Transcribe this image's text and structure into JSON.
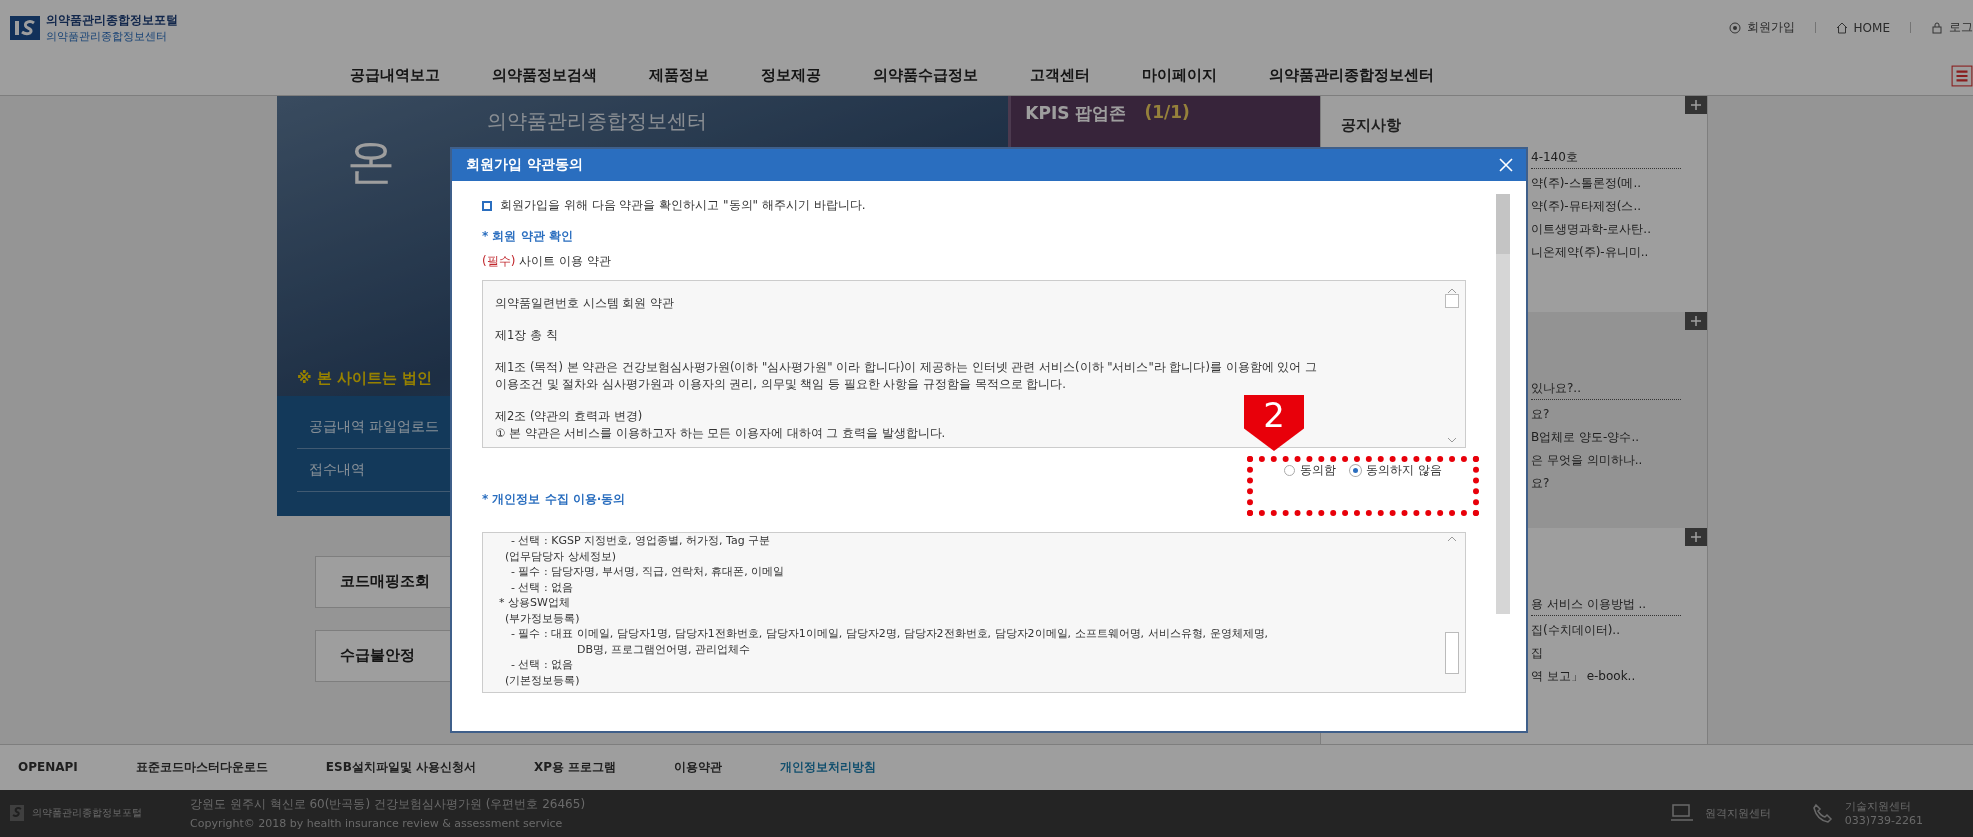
{
  "header": {
    "logo_title": "의약품관리종합정보포털",
    "logo_subtitle": "의약품관리종합정보센터",
    "links": [
      "회원가입",
      "HOME",
      "로그"
    ]
  },
  "nav": {
    "items": [
      "공급내역보고",
      "의약품정보검색",
      "제품정보",
      "정보제공",
      "의약품수급정보",
      "고객센터",
      "마이페이지",
      "의약품관리종합정보센터"
    ]
  },
  "banner": {
    "heading": "의약품관리종합정보센터",
    "big_text": "온",
    "notice": "※ 본 사이트는 법인",
    "menu": [
      "공급내역 파일업로드",
      "접수내역"
    ],
    "popup_title": "KPIS 팝업존",
    "popup_count": "(1/1)"
  },
  "quick_buttons": [
    "코드매핑조회",
    "수급불안정"
  ],
  "side_panels": [
    {
      "title": "공지사항",
      "items": [
        "4-140호",
        "약(주)-스톨론정(메..",
        "약(주)-뮤타제정(스..",
        "이트생명과학-로사탄..",
        "니온제약(주)-유니미.."
      ]
    },
    {
      "items": [
        "있나요?..",
        "요?",
        "B업체로 양도-양수..",
        "은 무엇을 의미하나..",
        "요?"
      ]
    },
    {
      "items": [
        "용 서비스 이용방법 ..",
        "집(수치데이터)..",
        "집",
        "역 보고」 e-book.."
      ]
    }
  ],
  "modal": {
    "title": "회원가입 약관동의",
    "intro": "회원가입을 위해 다음 약관을 확인하시고 \"동의\" 해주시기 바랍니다.",
    "section_1": {
      "title": "* 회원 약관 확인",
      "required_tag": "(필수)",
      "label": "사이트 이용 약관",
      "paragraphs": [
        [
          "의약품일련번호 시스템 회원 약관"
        ],
        [
          "제1장 총 칙"
        ],
        [
          "제1조 (목적) 본 약관은 건강보험심사평가원(이하 \"심사평가원\" 이라 합니다)이 제공하는 인터넷 관련 서비스(이하 \"서비스\"라 합니다)를 이용함에 있어 그",
          "이용조건 및 절차와 심사평가원과 이용자의 권리, 의무및 책임 등 필요한 사항을 규정함을 목적으로 합니다."
        ],
        [
          "제2조 (약관의 효력과 변경)",
          "① 본 약관은 서비스를 이용하고자 하는 모든 이용자에 대하여 그 효력을 발생합니다."
        ]
      ],
      "options": [
        {
          "label": "동의함",
          "selected": false
        },
        {
          "label": "동의하지 않음",
          "selected": true
        }
      ]
    },
    "section_2": {
      "title": "* 개인정보 수집 이용·동의",
      "lines": [
        "- 선택 : KGSP 지정번호, 영업종별, 허가정, Tag 구분",
        "(업무담당자 상세정보)",
        "- 필수 : 담당자명, 부서명, 직급, 연락처, 휴대폰, 이메일",
        "- 선택 : 없음",
        "* 상용SW업체",
        "(부가정보등록)",
        "- 필수 : 대표 이메일, 담당자1명, 담당자1전화번호, 담당자1이메일, 담당자2명, 담당자2전화번호, 담당자2이메일, 소프트웨어명, 서비스유형, 운영체제명,",
        "DB명, 프로그램언어명, 관리업체수",
        "- 선택 : 없음",
        "(기본정보등록)"
      ]
    },
    "step_marker": "2"
  },
  "footer": {
    "links": [
      {
        "label": "OPENAPI",
        "selected": false
      },
      {
        "label": "표준코드마스터다운로드",
        "selected": false
      },
      {
        "label": "ESB설치파일및 사용신청서",
        "selected": false
      },
      {
        "label": "XP용 프로그램",
        "selected": false
      },
      {
        "label": "이용약관",
        "selected": false
      },
      {
        "label": "개인정보처리방침",
        "selected": true
      }
    ],
    "logo": "의약품관리종합정보포털",
    "address": "강원도 원주시 혁신로 60(반곡동) 건강보험심사평가원 (우편번호 26465)",
    "copyright": "Copyright© 2018 by health insurance review & assessment service",
    "centers": [
      "원격지원센터",
      "기술지원센터"
    ],
    "phone": "033)739-2261"
  }
}
